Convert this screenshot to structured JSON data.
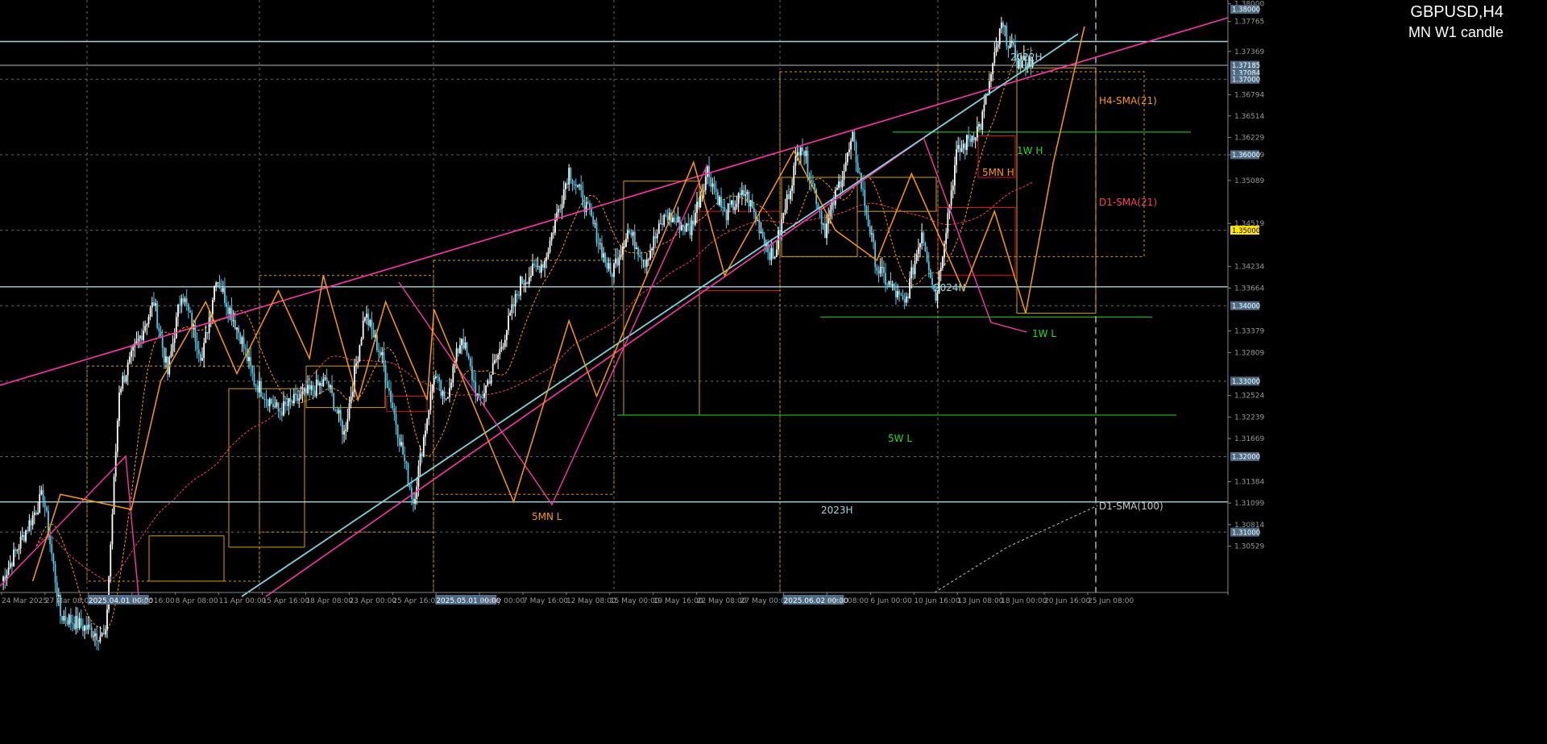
{
  "header": {
    "symbol": "GBPUSD,H4",
    "subtitle": "MN W1 candle"
  },
  "colors": {
    "background": "#000000",
    "grid": "#cfcfcf",
    "candle_up": "#ffffff",
    "candle_down": "#55c8e6",
    "h4_sma": "#ff9900",
    "d1_sma21": "#ff3b6b",
    "d1_sma100": "#c8c8c8",
    "wedge": "#ff33aa",
    "channel": "#7fd4de",
    "zigzag": "#ff9900",
    "box_gold": "#d7a000",
    "box_red": "#e01010",
    "week_level": "#22dd22",
    "key_level": "#9fd8e0",
    "round_level": "#ffe066"
  },
  "chart_data": {
    "type": "candlestick",
    "symbol": "GBPUSD",
    "timeframe": "H4",
    "ylim": [
      1.302,
      1.3805
    ],
    "y_ticks": [
      1.38,
      1.37765,
      1.37369,
      1.36794,
      1.36514,
      1.36229,
      1.36,
      1.35659,
      1.35089,
      1.34519,
      1.34234,
      1.33664,
      1.33379,
      1.32809,
      1.32524,
      1.32239,
      1.31669,
      1.31384,
      1.31099,
      1.30814,
      1.30529
    ],
    "y_tick_labels": [
      "1.38000",
      "1.37765",
      "1.37369",
      "1.36794",
      "1.36514",
      "1.36229",
      "1.35659",
      "1.35089",
      "1.34519",
      "1.34234",
      "1.33664",
      "1.33379",
      "1.32809",
      "1.32524",
      "1.32239",
      "1.31669",
      "1.31384",
      "1.31099",
      "1.30814",
      "1.30529"
    ],
    "price_tags": [
      {
        "price": 1.37185,
        "label": "1.37185",
        "highlight": false
      },
      {
        "price": 1.37084,
        "label": "1.37084",
        "highlight": false
      },
      {
        "price": 1.37,
        "label": "1.37000",
        "highlight": false
      },
      {
        "price": 1.36,
        "label": "1.36000",
        "highlight": false
      },
      {
        "price": 1.35,
        "label": "1.35000",
        "highlight": true
      },
      {
        "price": 1.34,
        "label": "1.34000",
        "highlight": false
      },
      {
        "price": 1.33,
        "label": "1.33000",
        "highlight": false
      },
      {
        "price": 1.32,
        "label": "1.32000",
        "highlight": false
      },
      {
        "price": 1.31,
        "label": "1.31000",
        "highlight": false
      }
    ],
    "x_labels": [
      "24 Mar 2025",
      "27 Mar 08:00",
      "2025.04.01 00:00",
      "3 Apr 16:00",
      "8 Apr 08:00",
      "11 Apr 00:00",
      "15 Apr 16:00",
      "18 Apr 08:00",
      "23 Apr 00:00",
      "25 Apr 16:00",
      "2025.05.01 00:00",
      "5 May 00:00",
      "7 May 16:00",
      "12 May 08:00",
      "15 May 00:00",
      "19 May 16:00",
      "22 May 08:00",
      "27 May 00:00",
      "2025.06.02 00:00",
      "3 Jun 08:00",
      "6 Jun 00:00",
      "10 Jun 16:00",
      "13 Jun 08:00",
      "18 Jun 00:00",
      "20 Jun 16:00",
      "25 Jun 08:00"
    ],
    "x_label_highlight": [
      false,
      false,
      true,
      false,
      false,
      false,
      false,
      false,
      false,
      false,
      true,
      false,
      false,
      false,
      false,
      false,
      false,
      false,
      true,
      false,
      false,
      false,
      false,
      false,
      false,
      false
    ],
    "bars_count": 560,
    "pivots": [
      [
        0,
        1.3035
      ],
      [
        24,
        1.315
      ],
      [
        34,
        1.299
      ],
      [
        60,
        1.296
      ],
      [
        68,
        1.329
      ],
      [
        88,
        1.3405
      ],
      [
        96,
        1.331
      ],
      [
        104,
        1.342
      ],
      [
        116,
        1.333
      ],
      [
        124,
        1.344
      ],
      [
        138,
        1.336
      ],
      [
        146,
        1.33
      ],
      [
        160,
        1.326
      ],
      [
        174,
        1.328
      ],
      [
        188,
        1.33
      ],
      [
        198,
        1.323
      ],
      [
        210,
        1.339
      ],
      [
        220,
        1.333
      ],
      [
        238,
        1.314
      ],
      [
        250,
        1.331
      ],
      [
        256,
        1.327
      ],
      [
        266,
        1.336
      ],
      [
        276,
        1.327
      ],
      [
        288,
        1.334
      ],
      [
        300,
        1.343
      ],
      [
        314,
        1.346
      ],
      [
        328,
        1.358
      ],
      [
        340,
        1.352
      ],
      [
        352,
        1.344
      ],
      [
        362,
        1.35
      ],
      [
        372,
        1.346
      ],
      [
        384,
        1.352
      ],
      [
        398,
        1.35
      ],
      [
        408,
        1.358
      ],
      [
        418,
        1.352
      ],
      [
        430,
        1.355
      ],
      [
        446,
        1.346
      ],
      [
        462,
        1.362
      ],
      [
        476,
        1.35
      ],
      [
        492,
        1.362
      ],
      [
        506,
        1.345
      ],
      [
        522,
        1.34
      ],
      [
        532,
        1.35
      ],
      [
        540,
        1.341
      ],
      [
        552,
        1.36
      ],
      [
        566,
        1.364
      ],
      [
        578,
        1.377
      ],
      [
        588,
        1.372
      ],
      [
        596,
        1.3725
      ]
    ],
    "series": [
      {
        "name": "H4-SMA(21)",
        "period": 21
      },
      {
        "name": "D1-SMA(21)",
        "period": 126
      },
      {
        "name": "D1-SMA(100)",
        "period": 600
      }
    ],
    "zigzag": [
      [
        18,
        1.3035
      ],
      [
        34,
        1.315
      ],
      [
        75,
        1.313
      ],
      [
        92,
        1.33
      ],
      [
        118,
        1.3405
      ],
      [
        136,
        1.331
      ],
      [
        160,
        1.342
      ],
      [
        178,
        1.333
      ],
      [
        186,
        1.344
      ],
      [
        206,
        1.3275
      ],
      [
        222,
        1.3405
      ],
      [
        246,
        1.3275
      ],
      [
        250,
        1.3395
      ],
      [
        296,
        1.314
      ],
      [
        328,
        1.338
      ],
      [
        344,
        1.328
      ],
      [
        400,
        1.359
      ],
      [
        418,
        1.344
      ],
      [
        458,
        1.3605
      ],
      [
        482,
        1.35
      ],
      [
        506,
        1.346
      ],
      [
        526,
        1.3575
      ],
      [
        556,
        1.342
      ],
      [
        574,
        1.3525
      ],
      [
        592,
        1.339
      ],
      [
        608,
        1.359
      ],
      [
        626,
        1.377
      ]
    ],
    "wedge_lines": [
      {
        "x1": 0,
        "y1": 1.307,
        "x2": 1920,
        "y2": 1.377,
        "kind": "screen_px"
      }
    ],
    "levels": [
      {
        "price": 1.375,
        "color_key": "key_level",
        "label": "2022H",
        "label_pos": [
          1268,
          0
        ]
      },
      {
        "price": 1.3425,
        "color_key": "key_level",
        "label": "2024H",
        "label_pos": [
          1175,
          0
        ]
      },
      {
        "price": 1.314,
        "color_key": "key_level",
        "label": "2023H",
        "label_pos": [
          1035,
          0
        ]
      },
      {
        "price": 1.363,
        "color_key": "week_level",
        "label": "1W H",
        "label_pos": [
          1278,
          0
        ]
      },
      {
        "price": 1.3385,
        "color_key": "week_level",
        "label": "1W L",
        "label_pos": [
          1295,
          0
        ]
      },
      {
        "price": 1.3255,
        "color_key": "week_level",
        "label": "5W L",
        "label_pos": [
          1117,
          0
        ]
      }
    ],
    "annotations": [
      {
        "text": "5MN H",
        "color_key": "zigzag"
      },
      {
        "text": "5MN L",
        "color_key": "zigzag"
      },
      {
        "text": "H4-SMA(21)",
        "color_key": "h4_sma"
      },
      {
        "text": "D1-SMA(21)",
        "color_key": "d1_sma21"
      },
      {
        "text": "D1-SMA(100)",
        "color_key": "d1_sma100"
      }
    ]
  }
}
